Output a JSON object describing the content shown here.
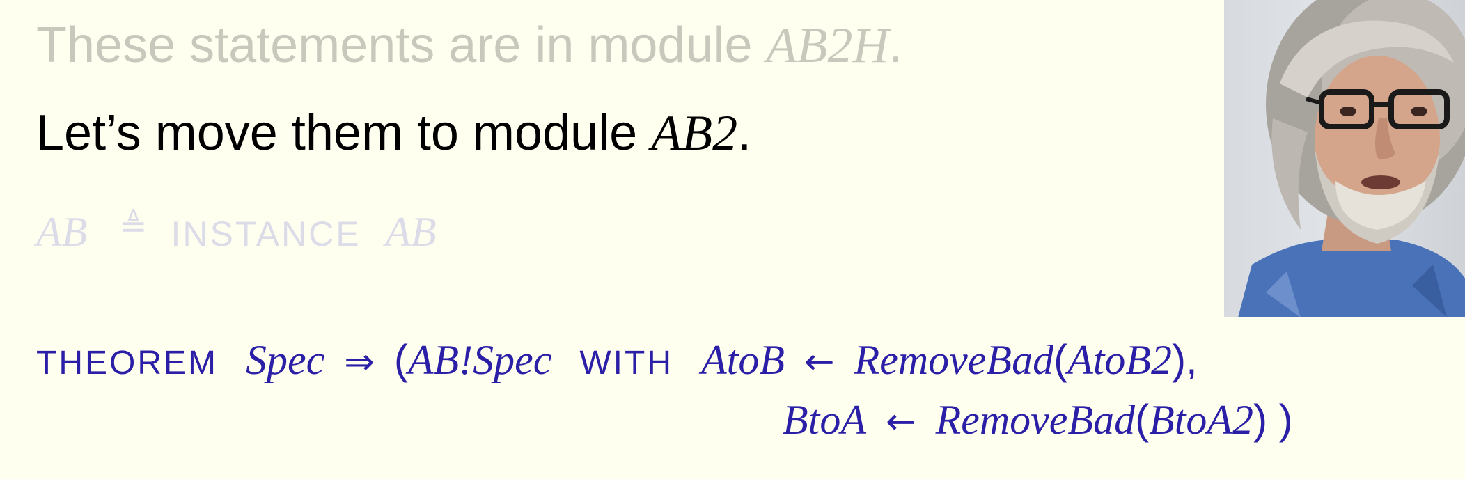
{
  "slide": {
    "line1": {
      "text": "These statements are in module ",
      "module": "AB2H",
      "end": "."
    },
    "line2": {
      "text": "Let’s move them to module ",
      "module": "AB2",
      "end": "."
    },
    "instance": {
      "lhs": "AB",
      "defeq": "≜",
      "keyword": "INSTANCE",
      "rhs": "AB"
    },
    "theorem": {
      "keyword": "THEOREM",
      "spec": "Spec",
      "implies": "⇒",
      "open": "(",
      "ab_spec": "AB!Spec",
      "with": "WITH",
      "sub1_var": "AtoB",
      "arrow": "←",
      "remove_bad": "RemoveBad",
      "sub1_arg": "AtoB2",
      "sub1_end": "),",
      "sub2_var": "BtoA",
      "sub2_arg": "BtoA2",
      "sub2_end": ") )"
    }
  },
  "colors": {
    "background": "#fffff0",
    "faded_text": "#c8c8bc",
    "faded_blue": "#dcdce8",
    "active_text": "#000000",
    "math_blue": "#2a1fa6"
  },
  "video": {
    "subject": "speaker-webcam"
  }
}
